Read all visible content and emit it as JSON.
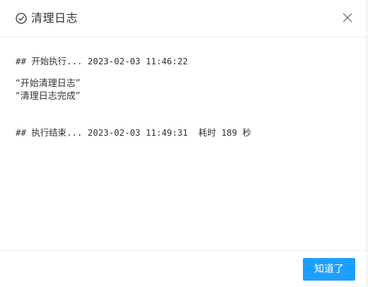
{
  "dialog": {
    "title": "清理日志",
    "title_icon": "check-circle-icon",
    "close_icon": "close-icon"
  },
  "log": {
    "start_line": "## 开始执行... 2023-02-03 11:46:22",
    "messages": [
      "“开始清理日志”",
      "“清理日志完成”"
    ],
    "end_line": "## 执行结束... 2023-02-03 11:49:31  耗时 189 秒"
  },
  "footer": {
    "ok_label": "知道了"
  },
  "colors": {
    "primary": "#1e9fff",
    "text": "#333333",
    "border": "#ececec"
  }
}
